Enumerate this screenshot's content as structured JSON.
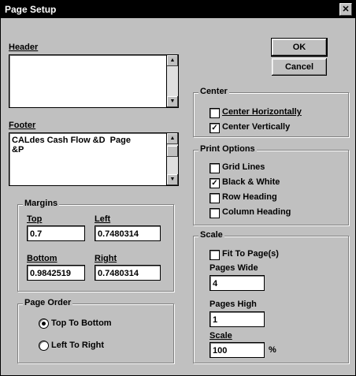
{
  "window": {
    "title": "Page Setup",
    "close_glyph": "✕"
  },
  "header": {
    "label": "Header",
    "value": ""
  },
  "footer": {
    "label": "Footer",
    "value": "CALdes Cash Flow &D  Page\n&P"
  },
  "buttons": {
    "ok": "OK",
    "cancel": "Cancel"
  },
  "margins": {
    "label": "Margins",
    "top": {
      "label": "Top",
      "value": "0.7"
    },
    "left": {
      "label": "Left",
      "value": "0.7480314"
    },
    "bottom": {
      "label": "Bottom",
      "value": "0.9842519"
    },
    "right": {
      "label": "Right",
      "value": "0.7480314"
    }
  },
  "page_order": {
    "label": "Page Order",
    "top_to_bottom": {
      "label": "Top To Bottom",
      "selected": true
    },
    "left_to_right": {
      "label": "Left To Right",
      "selected": false
    }
  },
  "center": {
    "label": "Center",
    "horizontally": {
      "label": "Center Horizontally",
      "checked": false
    },
    "vertically": {
      "label": "Center Vertically",
      "checked": true
    }
  },
  "print_options": {
    "label": "Print Options",
    "grid_lines": {
      "label": "Grid Lines",
      "checked": false
    },
    "black_white": {
      "label": "Black & White",
      "checked": true
    },
    "row_heading": {
      "label": "Row Heading",
      "checked": false
    },
    "column_heading": {
      "label": "Column Heading",
      "checked": false
    }
  },
  "scale": {
    "label": "Scale",
    "fit_to_pages": {
      "label": "Fit To Page(s)",
      "checked": false
    },
    "pages_wide": {
      "label": "Pages Wide",
      "value": "4"
    },
    "pages_high": {
      "label": "Pages High",
      "value": "1"
    },
    "scale_value": {
      "label": "Scale",
      "value": "100",
      "unit": "%"
    }
  },
  "glyphs": {
    "scroll_up": "▲",
    "scroll_down": "▼",
    "check": "✓"
  }
}
